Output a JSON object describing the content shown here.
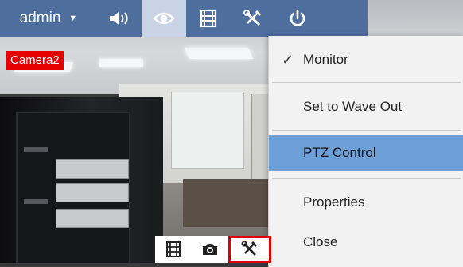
{
  "toolbar": {
    "username": "admin",
    "buttons": [
      {
        "icon": "speaker-icon",
        "active": false
      },
      {
        "icon": "eye-icon",
        "active": true
      },
      {
        "icon": "film-icon",
        "active": false
      },
      {
        "icon": "tools-icon",
        "active": false
      },
      {
        "icon": "power-icon",
        "active": false
      }
    ],
    "bg_color": "#4e6e9e",
    "active_color": "#c8d4e6"
  },
  "camera": {
    "name": "Camera2",
    "label_color": "#e60000"
  },
  "context_menu": {
    "items": [
      {
        "label": "Monitor",
        "checked": true
      },
      {
        "label": "Set to Wave Out",
        "checked": false
      },
      {
        "label": "PTZ Control",
        "checked": false,
        "highlighted": true
      },
      {
        "label": "Properties",
        "checked": false
      },
      {
        "label": "Close",
        "checked": false
      }
    ],
    "check_glyph": "✓",
    "highlight_color": "#6d9fd9"
  },
  "mini_toolbar": {
    "buttons": [
      {
        "icon": "film-icon"
      },
      {
        "icon": "camera-icon"
      },
      {
        "icon": "tools-icon",
        "selected": true
      }
    ],
    "selected_border_color": "#e00000"
  }
}
